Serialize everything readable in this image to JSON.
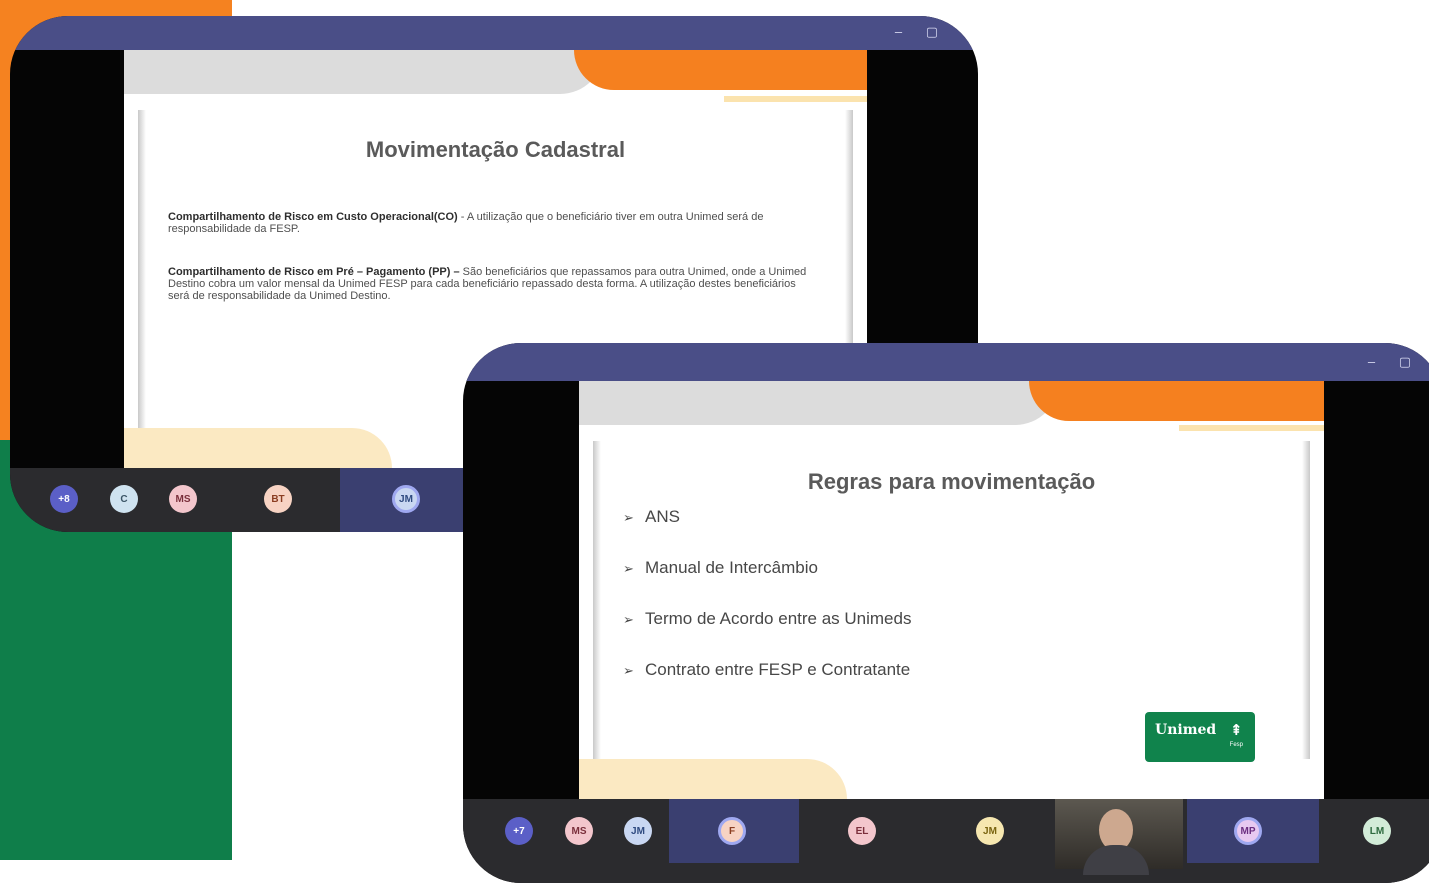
{
  "window1": {
    "controls": "–  ▢",
    "slide": {
      "title": "Movimentação Cadastral",
      "p1_bold": "Compartilhamento de Risco em Custo Operacional(CO)",
      "p1_text": " - A utilização que o beneficiário tiver em outra Unimed será de responsabilidade da FESP.",
      "p2_bold": "Compartilhamento de Risco em Pré – Pagamento (PP) –",
      "p2_text": " São beneficiários que repassamos para outra Unimed, onde a Unimed Destino cobra um valor mensal da Unimed FESP para cada beneficiário repassado desta forma. A utilização destes beneficiários será de responsabilidade da Unimed Destino."
    },
    "participants": [
      {
        "initials": "+8",
        "bg": "#5b5fc7",
        "fg": "#ffffff"
      },
      {
        "initials": "C",
        "bg": "#cfe3f0",
        "fg": "#3b5566"
      },
      {
        "initials": "MS",
        "bg": "#f3c6cc",
        "fg": "#7a2f3b"
      },
      {
        "initials": "BT",
        "bg": "#f7d3c3",
        "fg": "#8a3d21"
      },
      {
        "initials": "JM",
        "bg": "#c9d7f2",
        "fg": "#2f4a80"
      }
    ]
  },
  "window2": {
    "controls": "–  ▢",
    "slide": {
      "title": "Regras para movimentação",
      "bullets": [
        "ANS",
        "Manual de Intercâmbio",
        "Termo de Acordo entre as Unimeds",
        "Contrato entre FESP e Contratante"
      ],
      "logo_text": "Unimed",
      "logo_sub": "Fesp"
    },
    "participants": [
      {
        "initials": "+7",
        "bg": "#5b5fc7",
        "fg": "#ffffff"
      },
      {
        "initials": "MS",
        "bg": "#f3c6cc",
        "fg": "#7a2f3b"
      },
      {
        "initials": "JM",
        "bg": "#c9d7f2",
        "fg": "#2f4a80"
      },
      {
        "initials": "F",
        "bg": "#f7d3c3",
        "fg": "#8a3d21"
      },
      {
        "initials": "EL",
        "bg": "#f3c6cc",
        "fg": "#7a2f3b"
      },
      {
        "initials": "JM",
        "bg": "#f6e7b0",
        "fg": "#7a6410"
      },
      {
        "initials": "MP",
        "bg": "#e7c9f0",
        "fg": "#6b2f80"
      },
      {
        "initials": "LM",
        "bg": "#d2ecd8",
        "fg": "#2d6b3f"
      }
    ]
  },
  "colors": {
    "brand_orange": "#f58220",
    "brand_green": "#0f7e4a",
    "titlebar": "#4a4e87",
    "taskbar": "#2b2b2e"
  }
}
